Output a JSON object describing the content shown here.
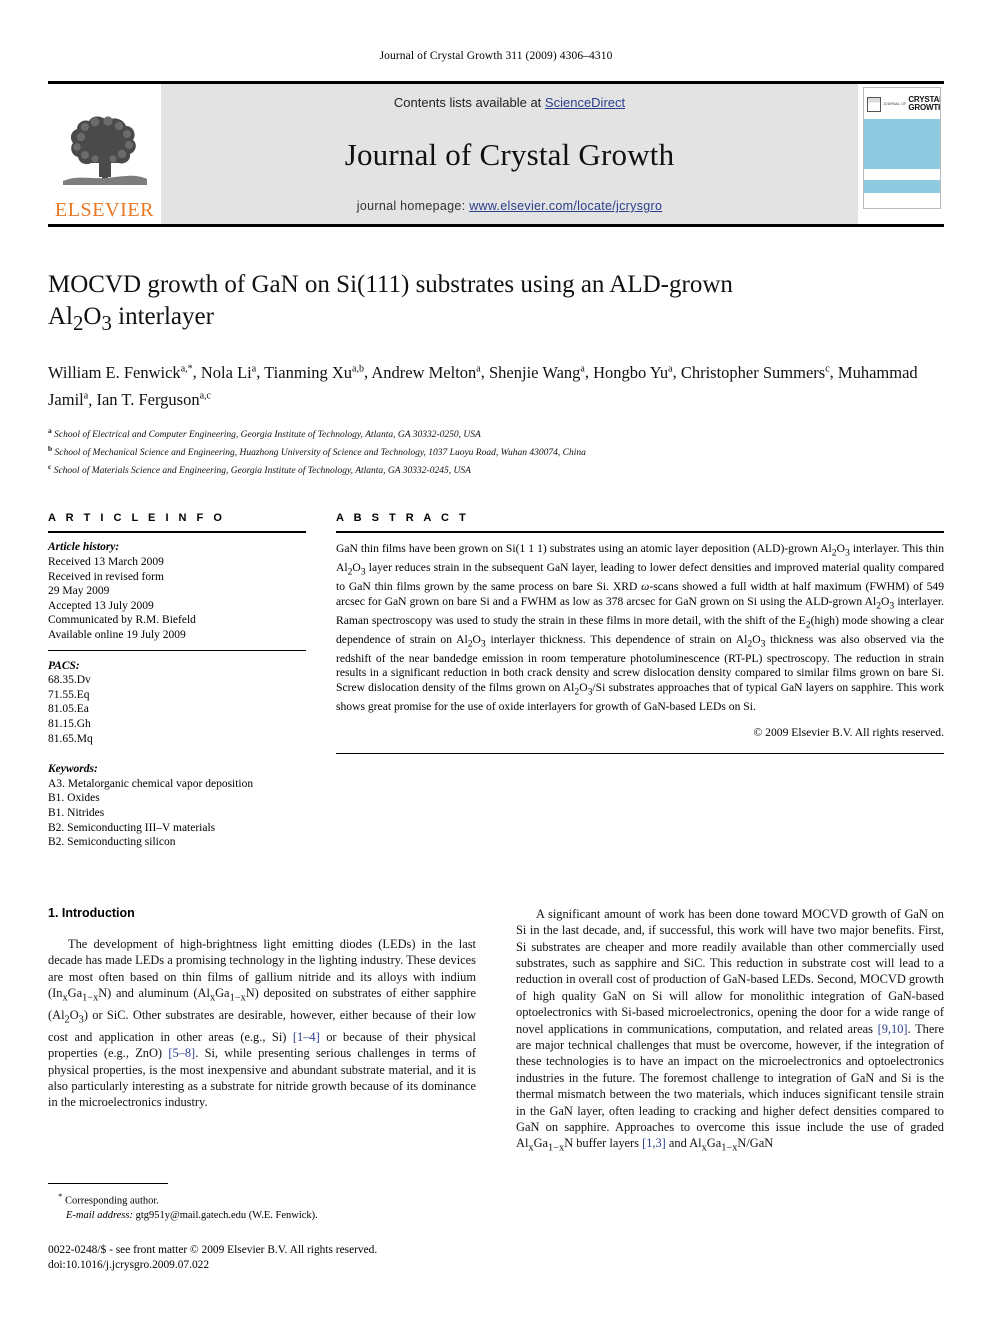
{
  "running_head": "Journal of Crystal Growth 311 (2009) 4306–4310",
  "masthead": {
    "publisher_logo_label": "ELSEVIER",
    "contents_prefix": "Contents lists available at",
    "contents_link": "ScienceDirect",
    "journal_name": "Journal of Crystal Growth",
    "homepage_prefix": "journal homepage:",
    "homepage_url": "www.elsevier.com/locate/jcrysgro",
    "cover": {
      "kicker": "JOURNAL OF",
      "line1": "CRYSTAL",
      "line2": "GROWTH",
      "band_color": "#8fcbe0"
    },
    "link_color": "#2b3f8c",
    "elsevier_orange": "#E87722"
  },
  "article": {
    "title_line1": "MOCVD growth of GaN on Si(111) substrates using an ALD-grown",
    "title_line2_pre": "Al",
    "title_line2_sub1": "2",
    "title_line2_mid": "O",
    "title_line2_sub2": "3",
    "title_line2_post": " interlayer",
    "authors": [
      {
        "name": "William E. Fenwick",
        "marks": "a,*"
      },
      {
        "name": "Nola Li",
        "marks": "a"
      },
      {
        "name": "Tianming Xu",
        "marks": "a,b"
      },
      {
        "name": "Andrew Melton",
        "marks": "a"
      },
      {
        "name": "Shenjie Wang",
        "marks": "a"
      },
      {
        "name": "Hongbo Yu",
        "marks": "a"
      },
      {
        "name": "Christopher Summers",
        "marks": "c"
      },
      {
        "name": "Muhammad Jamil",
        "marks": "a"
      },
      {
        "name": "Ian T. Ferguson",
        "marks": "a,c"
      }
    ],
    "affiliations": [
      {
        "mark": "a",
        "text": "School of Electrical and Computer Engineering, Georgia Institute of Technology, Atlanta, GA 30332-0250, USA"
      },
      {
        "mark": "b",
        "text": "School of Mechanical Science and Engineering, Huazhong University of Science and Technology, 1037 Luoyu Road, Wuhan 430074, China"
      },
      {
        "mark": "c",
        "text": "School of Materials Science and Engineering, Georgia Institute of Technology, Atlanta, GA 30332-0245, USA"
      }
    ]
  },
  "article_info": {
    "heading": "A R T I C L E  I N F O",
    "history_label": "Article history:",
    "history": [
      "Received 13 March 2009",
      "Received in revised form",
      "29 May 2009",
      "Accepted 13 July 2009",
      "Communicated by R.M. Biefeld",
      "Available online 19 July 2009"
    ],
    "pacs_label": "PACS:",
    "pacs": [
      "68.35.Dv",
      "71.55.Eq",
      "81.05.Ea",
      "81.15.Gh",
      "81.65.Mq"
    ],
    "keywords_label": "Keywords:",
    "keywords": [
      "A3. Metalorganic chemical vapor deposition",
      "B1. Oxides",
      "B1. Nitrides",
      "B2. Semiconducting III–V materials",
      "B2. Semiconducting silicon"
    ]
  },
  "abstract": {
    "heading": "A B S T R A C T",
    "paragraphs": [
      "GaN thin films have been grown on Si(1 1 1) substrates using an atomic layer deposition (ALD)-grown Al<sub>2</sub>O<sub>3</sub> interlayer. This thin Al<sub>2</sub>O<sub>3</sub> layer reduces strain in the subsequent GaN layer, leading to lower defect densities and improved material quality compared to GaN thin films grown by the same process on bare Si. XRD <i>ω</i>-scans showed a full width at half maximum (FWHM) of 549 arcsec for GaN grown on bare Si and a FWHM as low as 378 arcsec for GaN grown on Si using the ALD-grown Al<sub>2</sub>O<sub>3</sub> interlayer. Raman spectroscopy was used to study the strain in these films in more detail, with the shift of the E<sub>2</sub>(high) mode showing a clear dependence of strain on Al<sub>2</sub>O<sub>3</sub> interlayer thickness. This dependence of strain on Al<sub>2</sub>O<sub>3</sub> thickness was also observed via the redshift of the near bandedge emission in room temperature photoluminescence (RT-PL) spectroscopy. The reduction in strain results in a significant reduction in both crack density and screw dislocation density compared to similar films grown on bare Si. Screw dislocation density of the films grown on Al<sub>2</sub>O<sub>3</sub>/Si substrates approaches that of typical GaN layers on sapphire. This work shows great promise for the use of oxide interlayers for growth of GaN-based LEDs on Si."
    ],
    "copyright": "&copy; 2009 Elsevier B.V. All rights reserved."
  },
  "body": {
    "section_number_title": "1.  Introduction",
    "left_paragraph": "The development of high-brightness light emitting diodes (LEDs) in the last decade has made LEDs a promising technology in the lighting industry. These devices are most often based on thin films of gallium nitride and its alloys with indium (In<sub>x</sub>Ga<sub>1−x</sub>N) and aluminum (Al<sub>x</sub>Ga<sub>1−x</sub>N) deposited on substrates of either sapphire (Al<sub>2</sub>O<sub>3</sub>) or SiC. Other substrates are desirable, however, either because of their low cost and application in other areas (e.g., Si) <span class=\"ref\">[1–4]</span> or because of their physical properties (e.g., ZnO) <span class=\"ref\">[5–8]</span>. Si, while presenting serious challenges in terms of physical properties, is the most inexpensive and abundant substrate material, and it is also particularly interesting as a substrate for nitride growth because of its dominance in the microelectronics industry.",
    "right_paragraph": "A significant amount of work has been done toward MOCVD growth of GaN on Si in the last decade, and, if successful, this work will have two major benefits. First, Si substrates are cheaper and more readily available than other commercially used substrates, such as sapphire and SiC. This reduction in substrate cost will lead to a reduction in overall cost of production of GaN-based LEDs. Second, MOCVD growth of high quality GaN on Si will allow for monolithic integration of GaN-based optoelectronics with Si-based microelectronics, opening the door for a wide range of novel applications in communications, computation, and related areas <span class=\"ref\">[9,10]</span>. There are major technical challenges that must be overcome, however, if the integration of these technologies is to have an impact on the microelectronics and optoelectronics industries in the future. The foremost challenge to integration of GaN and Si is the thermal mismatch between the two materials, which induces significant tensile strain in the GaN layer, often leading to cracking and higher defect densities compared to GaN on sapphire. Approaches to overcome this issue include the use of graded Al<sub>x</sub>Ga<sub>1−x</sub>N buffer layers <span class=\"ref\">[1,3]</span> and Al<sub>x</sub>Ga<sub>1−x</sub>N/GaN"
  },
  "footnote": {
    "star": "*",
    "corresponding": "Corresponding author.",
    "email_label": "E-mail address:",
    "email": "gtg951y@mail.gatech.edu (W.E. Fenwick)."
  },
  "bottom_matter": {
    "issn_line": "0022-0248/$ - see front matter &copy; 2009 Elsevier B.V. All rights reserved.",
    "doi_line": "doi:10.1016/j.jcrysgro.2009.07.022"
  }
}
